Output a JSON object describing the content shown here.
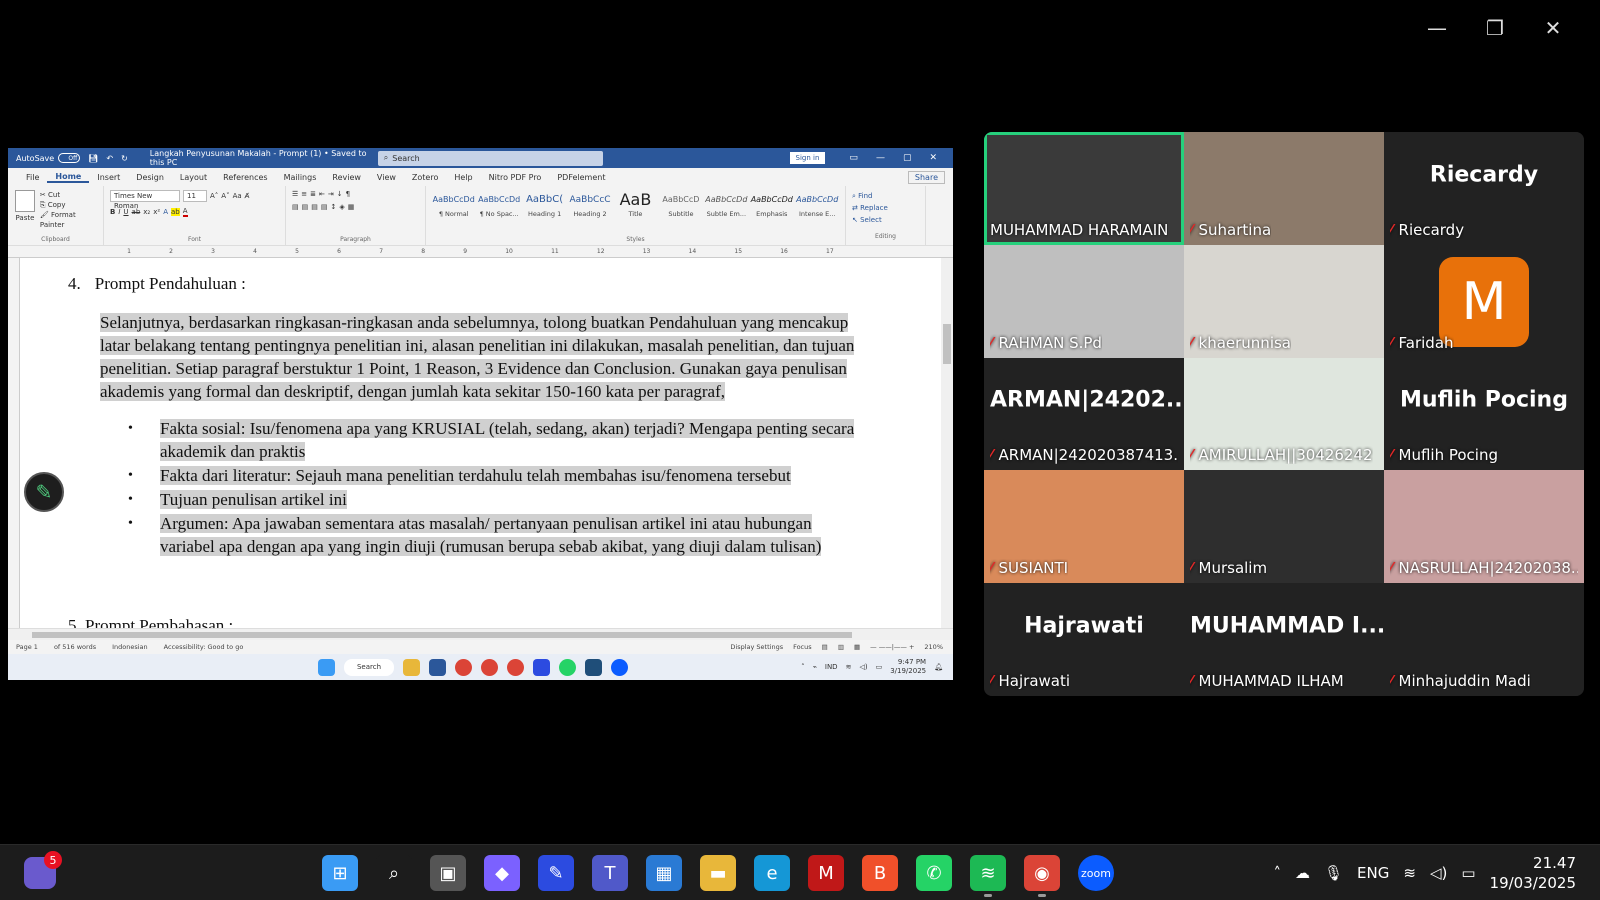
{
  "word": {
    "autosave_label": "AutoSave",
    "autosave_state": "Off",
    "doc_title": "Langkah Penyusunan Makalah - Prompt (1) • Saved to this PC",
    "search_placeholder": "Search",
    "signin_label": "Sign in",
    "menu": [
      "File",
      "Home",
      "Insert",
      "Design",
      "Layout",
      "References",
      "Mailings",
      "Review",
      "View",
      "Zotero",
      "Help",
      "Nitro PDF Pro",
      "PDFelement"
    ],
    "share_label": "Share",
    "clipboard": {
      "paste": "Paste",
      "cut": "Cut",
      "copy": "Copy",
      "format_painter": "Format Painter",
      "group": "Clipboard"
    },
    "font": {
      "name": "Times New Roman",
      "size": "11",
      "group": "Font"
    },
    "paragraph_group": "Paragraph",
    "styles": [
      {
        "sample": "AaBbCcDd",
        "name": "¶ Normal"
      },
      {
        "sample": "AaBbCcDd",
        "name": "¶ No Spac..."
      },
      {
        "sample": "AaBbC(",
        "name": "Heading 1"
      },
      {
        "sample": "AaBbCcC",
        "name": "Heading 2"
      },
      {
        "sample": "AaB",
        "name": "Title"
      },
      {
        "sample": "AaBbCcD",
        "name": "Subtitle"
      },
      {
        "sample": "AaBbCcDd",
        "name": "Subtle Em..."
      },
      {
        "sample": "AaBbCcDd",
        "name": "Emphasis"
      },
      {
        "sample": "AaBbCcDd",
        "name": "Intense E..."
      }
    ],
    "styles_group": "Styles",
    "editing": {
      "find": "Find",
      "replace": "Replace",
      "select": "Select",
      "group": "Editing"
    },
    "ruler_ticks": [
      "1",
      "2",
      "3",
      "4",
      "5",
      "6",
      "7",
      "8",
      "9",
      "10",
      "11",
      "12",
      "13",
      "14",
      "15",
      "16",
      "17"
    ],
    "doc": {
      "heading_num": "4.",
      "heading_text": "Prompt Pendahuluan :",
      "paragraph": "Selanjutnya, berdasarkan ringkasan-ringkasan anda sebelumnya, tolong buatkan Pendahuluan  yang mencakup latar belakang tentang pentingnya penelitian ini, alasan penelitian ini dilakukan, masalah penelitian, dan tujuan penelitian. Setiap paragraf berstuktur 1 Point, 1 Reason, 3 Evidence dan Conclusion. Gunakan gaya penulisan akademis yang formal dan deskriptif, dengan jumlah kata sekitar 150-160 kata per paragraf,",
      "bullets": [
        "Fakta sosial: Isu/fenomena apa yang KRUSIAL (telah, sedang, akan) terjadi? Mengapa penting secara akademik dan praktis",
        "Fakta dari literatur: Sejauh mana penelitian terdahulu telah membahas isu/fenomena tersebut",
        "Tujuan penulisan artikel ini",
        "Argumen: Apa jawaban sementara atas masalah/ pertanyaan penulisan artikel ini atau hubungan variabel apa dengan apa yang ingin diuji (rumusan berupa sebab akibat, yang diuji dalam tulisan)"
      ],
      "bullet_glyph": "•",
      "partial_next": "5.   Prompt Pembahasan :"
    },
    "status": {
      "page": "Page 1",
      "words": "of 516 words",
      "language": "Indonesian",
      "accessibility": "Accessibility: Good to go",
      "display": "Display Settings",
      "focus": "Focus",
      "zoom": "210%"
    },
    "inner_taskbar": {
      "search": "Search",
      "lang": "IND",
      "time": "9:47 PM",
      "date": "3/19/2025"
    }
  },
  "participants": [
    {
      "name": "MUHAMMAD HARAMAIN",
      "big": "",
      "muted": false,
      "speaking": true,
      "bg": "#3a3a3a"
    },
    {
      "name": "Suhartina",
      "big": "",
      "muted": true,
      "speaking": false,
      "bg": "#8c7a6a"
    },
    {
      "name": "Riecardy",
      "big": "Riecardy",
      "muted": true,
      "speaking": false,
      "bg": "#222222"
    },
    {
      "name": "RAHMAN S.Pd",
      "big": "",
      "muted": true,
      "speaking": false,
      "bg": "#bfbfbf"
    },
    {
      "name": "khaerunnisa",
      "big": "",
      "muted": true,
      "speaking": false,
      "bg": "#d8d6d0"
    },
    {
      "name": "Faridah",
      "big": "",
      "avatar": "M",
      "muted": true,
      "speaking": false,
      "bg": "#222222"
    },
    {
      "name": "ARMAN|242020387413...",
      "big": "ARMAN|24202...",
      "muted": true,
      "speaking": false,
      "bg": "#222222"
    },
    {
      "name": "AMIRULLAH||30426242",
      "big": "",
      "muted": true,
      "speaking": false,
      "bg": "#dfe6de"
    },
    {
      "name": "Muflih Pocing",
      "big": "Muflih Pocing",
      "muted": true,
      "speaking": false,
      "bg": "#222222"
    },
    {
      "name": "SUSIANTI",
      "big": "",
      "muted": true,
      "speaking": false,
      "bg": "#d98a5a"
    },
    {
      "name": "Mursalim",
      "big": "",
      "muted": true,
      "speaking": false,
      "bg": "#2e2e2e"
    },
    {
      "name": "NASRULLAH|24202038...",
      "big": "",
      "muted": true,
      "speaking": false,
      "bg": "#c9a0a0"
    },
    {
      "name": "Hajrawati",
      "big": "Hajrawati",
      "muted": true,
      "speaking": false,
      "bg": "#222222"
    },
    {
      "name": "MUHAMMAD ILHAM",
      "big": "MUHAMMAD I...",
      "muted": true,
      "speaking": false,
      "bg": "#222222"
    },
    {
      "name": "Minhajuddin Madi",
      "big": "",
      "muted": true,
      "speaking": false,
      "bg": "#222222"
    }
  ],
  "taskbar": {
    "widget_badge": "5",
    "apps": [
      {
        "name": "start",
        "glyph": "⊞",
        "color": "#3a9bf4"
      },
      {
        "name": "search",
        "glyph": "⌕",
        "color": "#1c1c1c"
      },
      {
        "name": "task-view",
        "glyph": "▣",
        "color": "#555555"
      },
      {
        "name": "copilot",
        "glyph": "◆",
        "color": "#7b61ff"
      },
      {
        "name": "app-blue",
        "glyph": "✎",
        "color": "#2c4be0"
      },
      {
        "name": "teams",
        "glyph": "T",
        "color": "#5059c9"
      },
      {
        "name": "store",
        "glyph": "▦",
        "color": "#2a7ad4"
      },
      {
        "name": "file-explorer",
        "glyph": "▬",
        "color": "#e8b73a"
      },
      {
        "name": "edge",
        "glyph": "e",
        "color": "#1597d6"
      },
      {
        "name": "mcafee",
        "glyph": "M",
        "color": "#c01818"
      },
      {
        "name": "brave",
        "glyph": "B",
        "color": "#f0502a"
      },
      {
        "name": "whatsapp",
        "glyph": "✆",
        "color": "#25d366"
      },
      {
        "name": "spotify",
        "glyph": "≋",
        "color": "#1db954"
      },
      {
        "name": "chrome",
        "glyph": "◉",
        "color": "#db4437"
      },
      {
        "name": "zoom",
        "glyph": "zoom",
        "color": "#0b5cff"
      }
    ],
    "lang": "ENG",
    "time": "21.47",
    "date": "19/03/2025"
  }
}
